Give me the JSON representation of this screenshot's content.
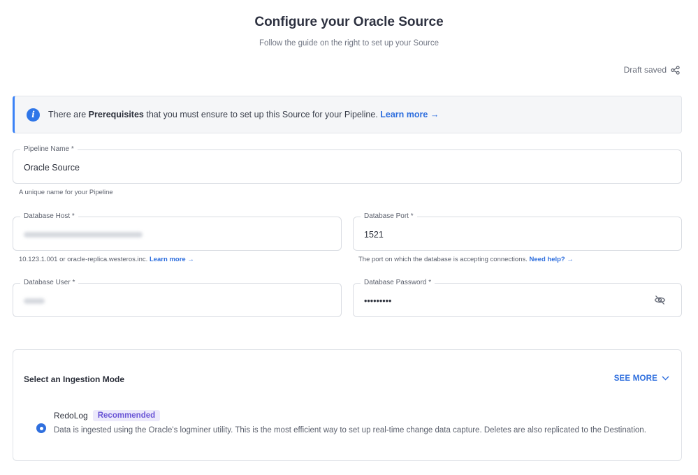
{
  "header": {
    "title": "Configure your Oracle Source",
    "subtitle": "Follow the guide on the right to set up your Source",
    "draft_status": "Draft saved"
  },
  "banner": {
    "text_before": "There are ",
    "bold": "Prerequisites",
    "text_after": " that you must ensure to set up this Source for your Pipeline. ",
    "link": "Learn more →"
  },
  "fields": {
    "pipeline_name": {
      "label": "Pipeline Name *",
      "value": "Oracle Source",
      "help": "A unique name for your Pipeline"
    },
    "db_host": {
      "label": "Database Host *",
      "help": "10.123.1.001 or oracle-replica.westeros.inc.",
      "help_link": "Learn more →"
    },
    "db_port": {
      "label": "Database Port *",
      "value": "1521",
      "help": "The port on which the database is accepting connections.",
      "help_link": "Need help? →"
    },
    "db_user": {
      "label": "Database User *"
    },
    "db_password": {
      "label": "Database Password *",
      "value": "•••••••••"
    }
  },
  "ingestion": {
    "title": "Select an Ingestion Mode",
    "see_more": "SEE MORE",
    "mode": {
      "name": "RedoLog",
      "badge": "Recommended",
      "description": "Data is ingested using the Oracle's logminer utility. This is the most efficient way to set up real-time change data capture. Deletes are also replicated to the Destination."
    }
  },
  "icons": {
    "banner": "info-icon",
    "draft": "share-icon",
    "password": "eye-slash-icon",
    "see_more": "chevron-down-icon"
  },
  "colors": {
    "accent": "#2f6fde",
    "badge_bg": "#ece9fb",
    "badge_text": "#6a55d6"
  }
}
